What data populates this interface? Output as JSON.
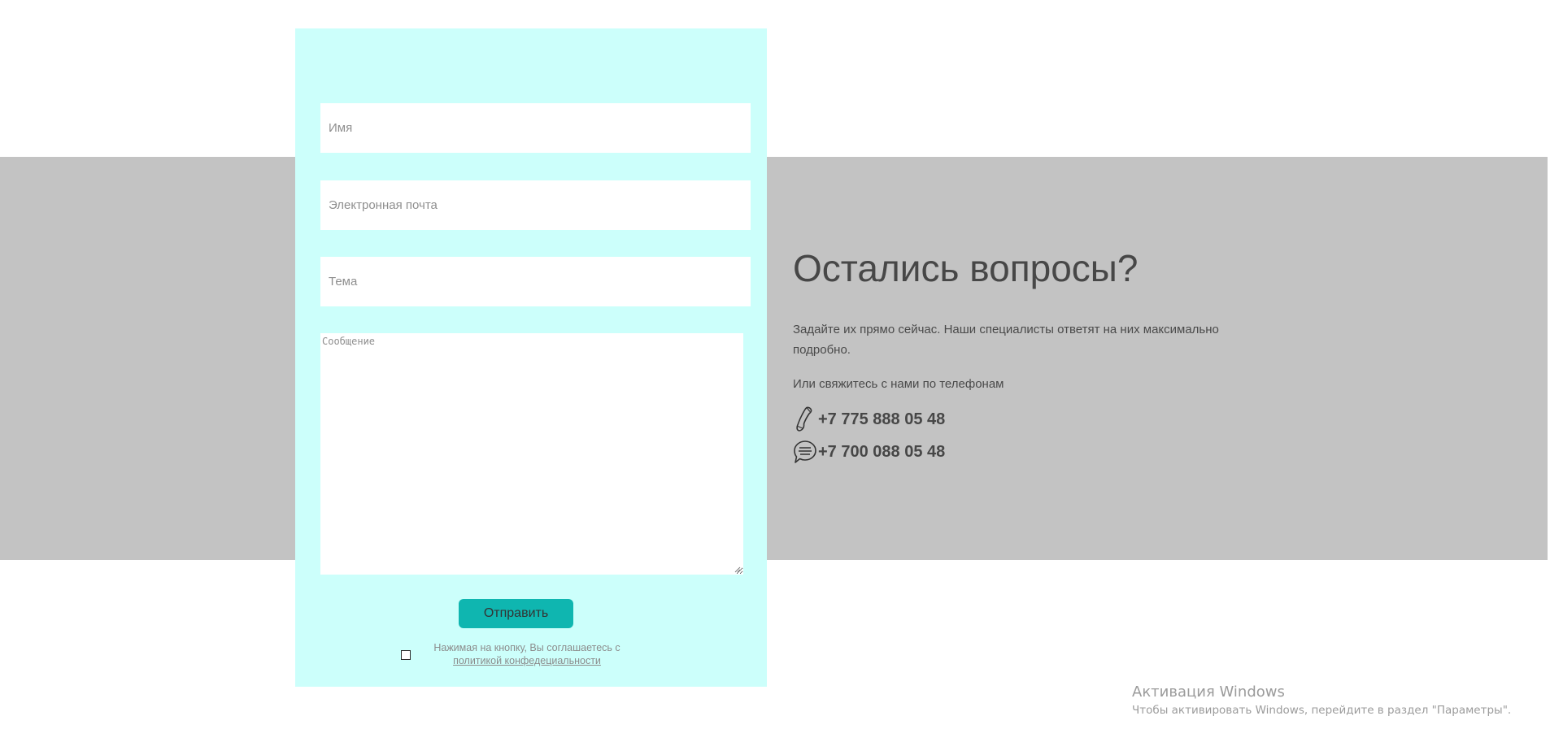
{
  "form": {
    "name_placeholder": "Имя",
    "email_placeholder": "Электронная почта",
    "subject_placeholder": "Тема",
    "message_placeholder": "Сообщение",
    "submit_label": "Отправить",
    "consent_text": "Нажимая на кнопку, Вы соглашаетесь с",
    "consent_link": "политикой конфедециальности",
    "consent_checked": false
  },
  "contact": {
    "heading": "Остались вопросы?",
    "description": "Задайте их прямо сейчас. Наши специалисты ответят на них максимально подробно.",
    "call_prompt": "Или свяжитесь с нами по телефонам",
    "phones": [
      {
        "number": "+7 775 888 05 48",
        "icon": "phone-handset-icon"
      },
      {
        "number": "+7 700 088 05 48",
        "icon": "chat-bubble-icon"
      }
    ]
  },
  "watermark": {
    "title": "Активация Windows",
    "subtitle": "Чтобы активировать Windows, перейдите в раздел \"Параметры\"."
  },
  "colors": {
    "form_background": "#ccfffb",
    "band_background": "#c3c3c3",
    "button_background": "#0fb6b0",
    "heading_text": "#474747"
  }
}
